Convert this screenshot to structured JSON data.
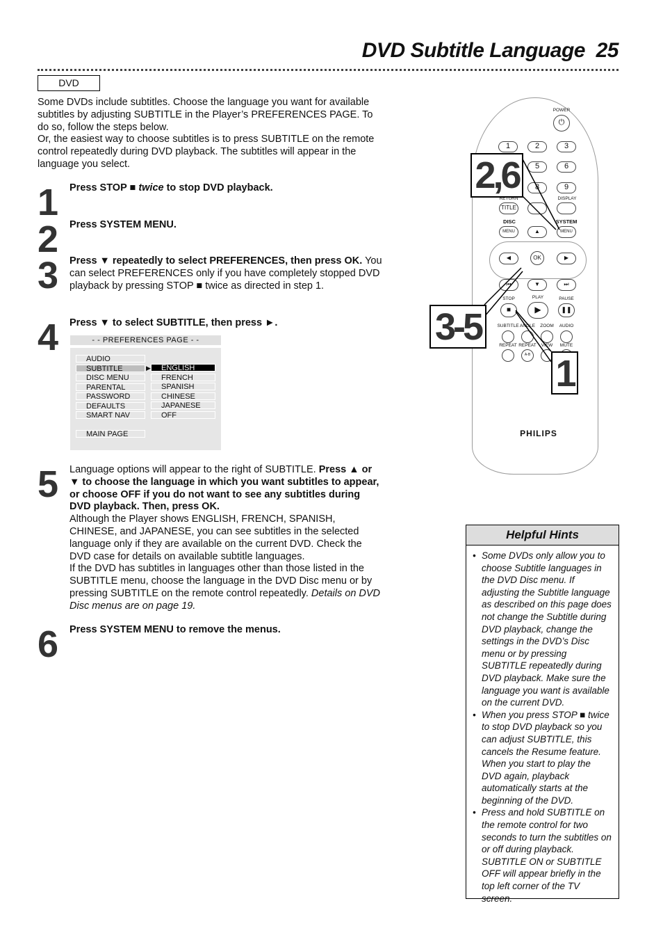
{
  "header": {
    "title": "DVD Subtitle Language",
    "page_number": "25"
  },
  "badge": "DVD",
  "intro": "Some DVDs include subtitles. Choose the language you want for available subtitles by adjusting SUBTITLE in the Player’s PREFERENCES PAGE. To do so, follow the steps below.\nOr, the easiest way to choose subtitles is to press SUBTITLE on the remote control repeatedly during DVD playback. The subtitles will appear in the language you select.",
  "steps": [
    {
      "num": "1",
      "segments": [
        {
          "s": "b",
          "t": "Press STOP ■ "
        },
        {
          "s": "bi",
          "t": "twice"
        },
        {
          "s": "b",
          "t": " to stop DVD playback."
        }
      ]
    },
    {
      "num": "2",
      "segments": [
        {
          "s": "b",
          "t": "Press SYSTEM MENU."
        }
      ]
    },
    {
      "num": "3",
      "segments": [
        {
          "s": "b",
          "t": "Press ▼ repeatedly to select PREFERENCES, then press OK."
        },
        {
          "s": "n",
          "t": " You can select PREFERENCES only if you have completely stopped DVD playback by pressing STOP ■ twice as directed in step 1."
        }
      ]
    },
    {
      "num": "4",
      "segments": [
        {
          "s": "b",
          "t": "Press ▼ to select SUBTITLE, then press ►."
        }
      ]
    },
    {
      "num": "5",
      "segments": [
        {
          "s": "n",
          "t": "Language options will appear to the right of SUBTITLE. "
        },
        {
          "s": "b",
          "t": "Press ▲ or ▼ to choose the language in which you want subtitles to appear, or choose OFF if you do not want to see any subtitles during DVD playback. Then, press OK."
        },
        {
          "s": "n",
          "t": "\nAlthough the Player shows ENGLISH, FRENCH, SPANISH, CHINESE, and JAPANESE, you can see subtitles in the selected language only if they are available on the current DVD. Check the DVD case for details on available subtitle languages.\nIf the DVD has subtitles in languages other than those listed in the SUBTITLE menu, choose the language in the DVD Disc menu or by pressing SUBTITLE on the remote control repeatedly. "
        },
        {
          "s": "i",
          "t": "Details on DVD Disc menus are on page 19."
        }
      ]
    },
    {
      "num": "6",
      "segments": [
        {
          "s": "b",
          "t": "Press SYSTEM MENU to remove the menus."
        }
      ]
    }
  ],
  "menu": {
    "title": "- -  PREFERENCES PAGE  - -",
    "items": [
      "AUDIO",
      "SUBTITLE",
      "DISC MENU",
      "PARENTAL",
      "PASSWORD",
      "DEFAULTS",
      "SMART NAV"
    ],
    "options": [
      "ENGLISH",
      "FRENCH",
      "SPANISH",
      "CHINESE",
      "JAPANESE",
      "OFF"
    ],
    "selected_item": "SUBTITLE",
    "selected_option": "ENGLISH",
    "main_page": "MAIN PAGE"
  },
  "remote": {
    "brand": "PHILIPS",
    "power": "POWER",
    "digits": [
      "1",
      "2",
      "3",
      "5",
      "6",
      "8",
      "9"
    ],
    "labels": {
      "return": "RETURN",
      "title": "TITLE",
      "display": "DISPLAY",
      "disc": "DISC",
      "menu": "MENU",
      "system": "SYSTEM",
      "ok": "OK",
      "stop": "STOP",
      "play": "PLAY",
      "pause": "PAUSE",
      "subtitle": "SUBTITLE",
      "angle": "ANGLE",
      "zoom": "ZOOM",
      "audio": "AUDIO",
      "repeat": "REPEAT",
      "repeat_ab": "REPEAT",
      "ab": "A-B",
      "view": "VIEW",
      "mute": "MUTE"
    },
    "callouts": [
      "2,6",
      "3-5",
      "1"
    ]
  },
  "hints": {
    "title": "Helpful Hints",
    "items": [
      "Some DVDs only allow you to choose Subtitle languages in the DVD Disc menu. If adjusting the Subtitle language as described on this page does not change the Subtitle during DVD playback, change the settings in the DVD’s Disc menu or by pressing SUBTITLE repeatedly during DVD playback. Make sure the language you want is available on the current DVD.",
      "When you press STOP ■ twice to stop DVD playback so you can adjust SUBTITLE, this cancels the Resume feature. When you start to play the DVD again, playback automatically starts at the beginning of the DVD.",
      "Press and hold SUBTITLE on the remote control for two seconds to turn the subtitles on or off during playback. SUBTITLE ON or SUBTITLE OFF will appear briefly in the top left corner of the TV screen."
    ]
  }
}
